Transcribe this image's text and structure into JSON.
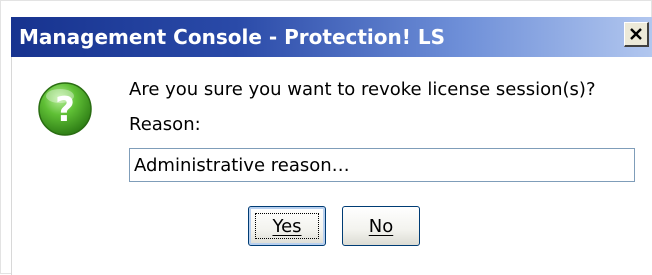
{
  "window": {
    "title": "Management Console - Protection! LS",
    "close_icon": "close-icon"
  },
  "dialog": {
    "icon": "question-icon",
    "message": "Are you sure you want to revoke license session(s)?",
    "reason_label": "Reason:",
    "reason_value": "Administrative reason…"
  },
  "buttons": {
    "yes_label": "Yes",
    "no_label": "No"
  },
  "colors": {
    "titlebar_start": "#17338f",
    "titlebar_end": "#b2c7ef",
    "icon_green": "#4caf2f"
  }
}
